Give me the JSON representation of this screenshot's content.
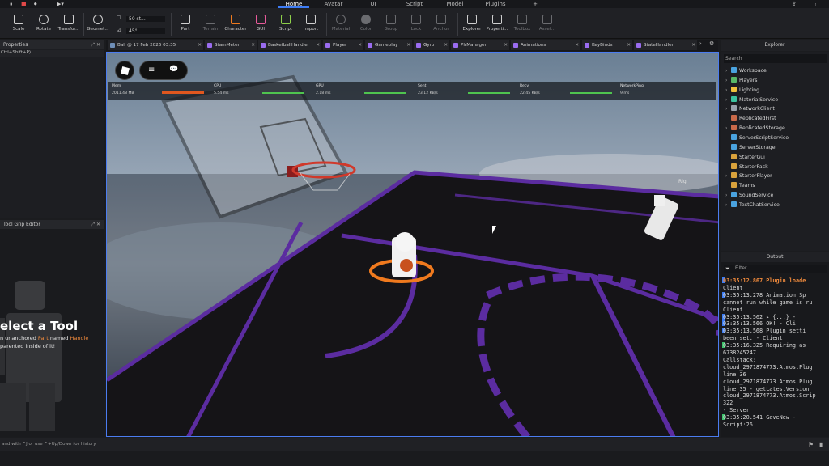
{
  "menubar": {
    "tabs": [
      "Home",
      "Avatar",
      "UI",
      "Script",
      "Model",
      "Plugins"
    ],
    "active": "Home",
    "more": "+"
  },
  "ribbon": {
    "tools": [
      "Scale",
      "Rotate",
      "Transfor...",
      "Geomet...",
      "Part",
      "Terrain",
      "Character",
      "GUI",
      "Script",
      "Import",
      "Material",
      "Color",
      "Group",
      "Lock",
      "Anchor",
      "Explorer",
      "Properti...",
      "Toolbox",
      "Asset..."
    ],
    "move_increment": "50 st...",
    "rotate_increment": "45°"
  },
  "left": {
    "properties_title": "Properties",
    "properties_hint": "Ctrl+Shift+P)",
    "grip_title": "Tool Grip Editor",
    "select_tool_heading": "elect a Tool",
    "select_tool_line1_prefix": "n unanchored ",
    "select_tool_part": "Part",
    "select_tool_named": " named ",
    "select_tool_handle": "Handle",
    "select_tool_line2": "parented inside of it!"
  },
  "doc_tabs": [
    {
      "label": "Ball @ 17 Feb 2026 03:35",
      "color": "#9a6cf0"
    },
    {
      "label": "StamMeter",
      "color": "#9a6cf0"
    },
    {
      "label": "BasketballHandler",
      "color": "#9a6cf0"
    },
    {
      "label": "Player",
      "color": "#9a6cf0"
    },
    {
      "label": "Gameplay",
      "color": "#9a6cf0"
    },
    {
      "label": "Gyro",
      "color": "#9a6cf0"
    },
    {
      "label": "PlrManager",
      "color": "#9a6cf0"
    },
    {
      "label": "Animations",
      "color": "#9a6cf0"
    },
    {
      "label": "KeyBinds",
      "color": "#9a6cf0"
    },
    {
      "label": "StateHandler",
      "color": "#9a6cf0"
    }
  ],
  "hud": {
    "mem_label": "Mem",
    "mem_value": "2011.48 MB",
    "cpu_label": "CPU",
    "cpu_value": "5.54 ms",
    "gpu_label": "GPU",
    "gpu_value": "2.18 ms",
    "sent_label": "Sent",
    "sent_value": "23.12 KB/s",
    "recv_label": "Recv",
    "recv_value": "22.45 KB/s",
    "ping_label": "NetworkPing",
    "ping_value": "9 ms",
    "rig_label": "Rig"
  },
  "explorer": {
    "title": "Explorer",
    "search_placeholder": "Search",
    "items": [
      {
        "label": "Workspace",
        "icon": "#4aa3df",
        "chev": "›"
      },
      {
        "label": "Players",
        "icon": "#58b968",
        "chev": "›"
      },
      {
        "label": "Lighting",
        "icon": "#f0c23c",
        "chev": "›"
      },
      {
        "label": "MaterialService",
        "icon": "#3cc3a0",
        "chev": "›"
      },
      {
        "label": "NetworkClient",
        "icon": "#9aa3ad",
        "chev": "›"
      },
      {
        "label": "ReplicatedFirst",
        "icon": "#c96a4a",
        "chev": ""
      },
      {
        "label": "ReplicatedStorage",
        "icon": "#c96a4a",
        "chev": "›"
      },
      {
        "label": "ServerScriptService",
        "icon": "#4aa3df",
        "chev": ""
      },
      {
        "label": "ServerStorage",
        "icon": "#4aa3df",
        "chev": ""
      },
      {
        "label": "StarterGui",
        "icon": "#d9a23c",
        "chev": ""
      },
      {
        "label": "StarterPack",
        "icon": "#d9a23c",
        "chev": ""
      },
      {
        "label": "StarterPlayer",
        "icon": "#d9a23c",
        "chev": "›"
      },
      {
        "label": "Teams",
        "icon": "#d9a23c",
        "chev": ""
      },
      {
        "label": "SoundService",
        "icon": "#4aa3df",
        "chev": "›"
      },
      {
        "label": "TextChatService",
        "icon": "#4aa3df",
        "chev": "›"
      }
    ]
  },
  "output": {
    "title": "Output",
    "filter_placeholder": "Filter...",
    "lines": [
      {
        "text": "03:35:12.867  Plugin loade",
        "style": "orange",
        "bar": "b"
      },
      {
        "text": "Client",
        "style": "",
        "bar": ""
      },
      {
        "text": "03:35:13.278  Animation Sp",
        "style": "",
        "bar": "b"
      },
      {
        "text": "cannot run while game is ru",
        "style": "",
        "bar": ""
      },
      {
        "text": "Client",
        "style": "",
        "bar": ""
      },
      {
        "text": "03:35:13.562   ▸ {...}  -",
        "style": "",
        "bar": "b"
      },
      {
        "text": "03:35:13.566  OK!  -  Cli",
        "style": "",
        "bar": "b"
      },
      {
        "text": "03:35:13.568  Plugin setti",
        "style": "",
        "bar": "b"
      },
      {
        "text": "been set.  -  Client",
        "style": "",
        "bar": ""
      },
      {
        "text": "03:35:16.325  Requiring as",
        "style": "",
        "bar": "g"
      },
      {
        "text": "6738245247.",
        "style": "",
        "bar": ""
      },
      {
        "text": "Callstack:",
        "style": "",
        "bar": ""
      },
      {
        "text": "cloud_2971874773.Atmos.Plug",
        "style": "",
        "bar": ""
      },
      {
        "text": "line 36",
        "style": "",
        "bar": ""
      },
      {
        "text": "cloud_2971874773.Atmos.Plug",
        "style": "",
        "bar": ""
      },
      {
        "text": "line 35 - getLatestVersion",
        "style": "",
        "bar": ""
      },
      {
        "text": "cloud_2971874773.Atmos.Scrip",
        "style": "",
        "bar": ""
      },
      {
        "text": "322",
        "style": "",
        "bar": ""
      },
      {
        "text": "  -  Server",
        "style": "",
        "bar": ""
      },
      {
        "text": "03:35:20.541  GaveNew  -",
        "style": "",
        "bar": "g"
      },
      {
        "text": "Script:26",
        "style": "",
        "bar": ""
      }
    ]
  },
  "command_bar": {
    "hint": "and with ^J or use ^+Up/Down for history"
  },
  "colors": {
    "accent": "#3d7cf5",
    "court_line": "#5b2ca0",
    "ring": "#f07a1e",
    "hoop": "#d0392b"
  }
}
